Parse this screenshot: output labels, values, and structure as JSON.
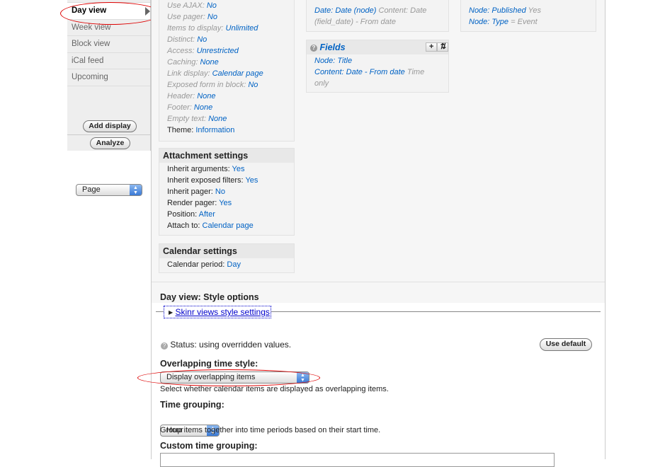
{
  "sidebar": {
    "tabs": [
      "Day view",
      "Week view",
      "Block view",
      "iCal feed",
      "Upcoming"
    ],
    "display_select": "Page",
    "add_display": "Add display",
    "analyze": "Analyze"
  },
  "basic_settings": [
    {
      "label": "Use AJAX:",
      "value": "No"
    },
    {
      "label": "Use pager:",
      "value": "No"
    },
    {
      "label": "Items to display:",
      "value": "Unlimited"
    },
    {
      "label": "Distinct:",
      "value": "No"
    },
    {
      "label": "Access:",
      "value": "Unrestricted"
    },
    {
      "label": "Caching:",
      "value": "None"
    },
    {
      "label": "Link display:",
      "value": "Calendar page"
    },
    {
      "label": "Exposed form in block:",
      "value": "No"
    },
    {
      "label": "Header:",
      "value": "None"
    },
    {
      "label": "Footer:",
      "value": "None"
    },
    {
      "label": "Empty text:",
      "value": "None"
    },
    {
      "label": "Theme:",
      "value": "Information"
    }
  ],
  "attachment": {
    "title": "Attachment settings",
    "rows": [
      {
        "label": "Inherit arguments:",
        "value": "Yes"
      },
      {
        "label": "Inherit exposed filters:",
        "value": "Yes"
      },
      {
        "label": "Inherit pager:",
        "value": "No"
      },
      {
        "label": "Render pager:",
        "value": "Yes"
      },
      {
        "label": "Position:",
        "value": "After"
      },
      {
        "label": "Attach to:",
        "value": "Calendar page"
      }
    ]
  },
  "calendar": {
    "title": "Calendar settings",
    "label": "Calendar period:",
    "value": "Day"
  },
  "arguments": {
    "link": "Date: Date (node)",
    "detail": "Content: Date (field_date) - From date"
  },
  "fields": {
    "title": "Fields",
    "items": [
      {
        "link": "Node: Title",
        "detail": ""
      },
      {
        "link": "Content: Date - From date",
        "detail": "Time only"
      }
    ]
  },
  "filters": [
    {
      "link": "Node: Published",
      "detail": "Yes"
    },
    {
      "link": "Node: Type",
      "detail": "= Event"
    }
  ],
  "style": {
    "title": "Day view: Style options",
    "skinr_link": "Skinr views style settings",
    "status": "Status: using overridden values.",
    "use_default": "Use default",
    "overlap_label": "Overlapping time style:",
    "overlap_value": "Display overlapping items",
    "overlap_desc": "Select whether calendar items are displayed as overlapping items.",
    "grouping_label": "Time grouping:",
    "grouping_value": "Hour",
    "grouping_desc": "Group items together into time periods based on their start time.",
    "custom_label": "Custom time grouping:",
    "custom_value": ""
  }
}
